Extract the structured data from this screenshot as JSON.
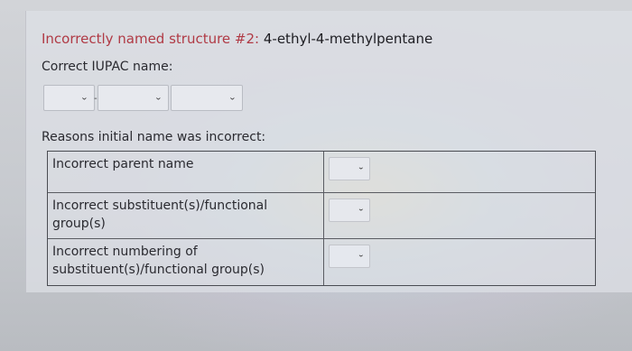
{
  "question": {
    "title_prefix": "Incorrectly named structure #2:",
    "title_name": " 4-ethyl-4-methylpentane",
    "correct_name_label": "Correct IUPAC name:",
    "dash": "-",
    "reasons_label": "Reasons initial name was incorrect:"
  },
  "reasons": [
    {
      "label": "Incorrect parent name"
    },
    {
      "label": "Incorrect substituent(s)/functional group(s)"
    },
    {
      "label": "Incorrect numbering of substituent(s)/functional group(s)"
    }
  ],
  "icons": {
    "dropdown": "chevron-down-icon",
    "glyph": "⌄"
  }
}
